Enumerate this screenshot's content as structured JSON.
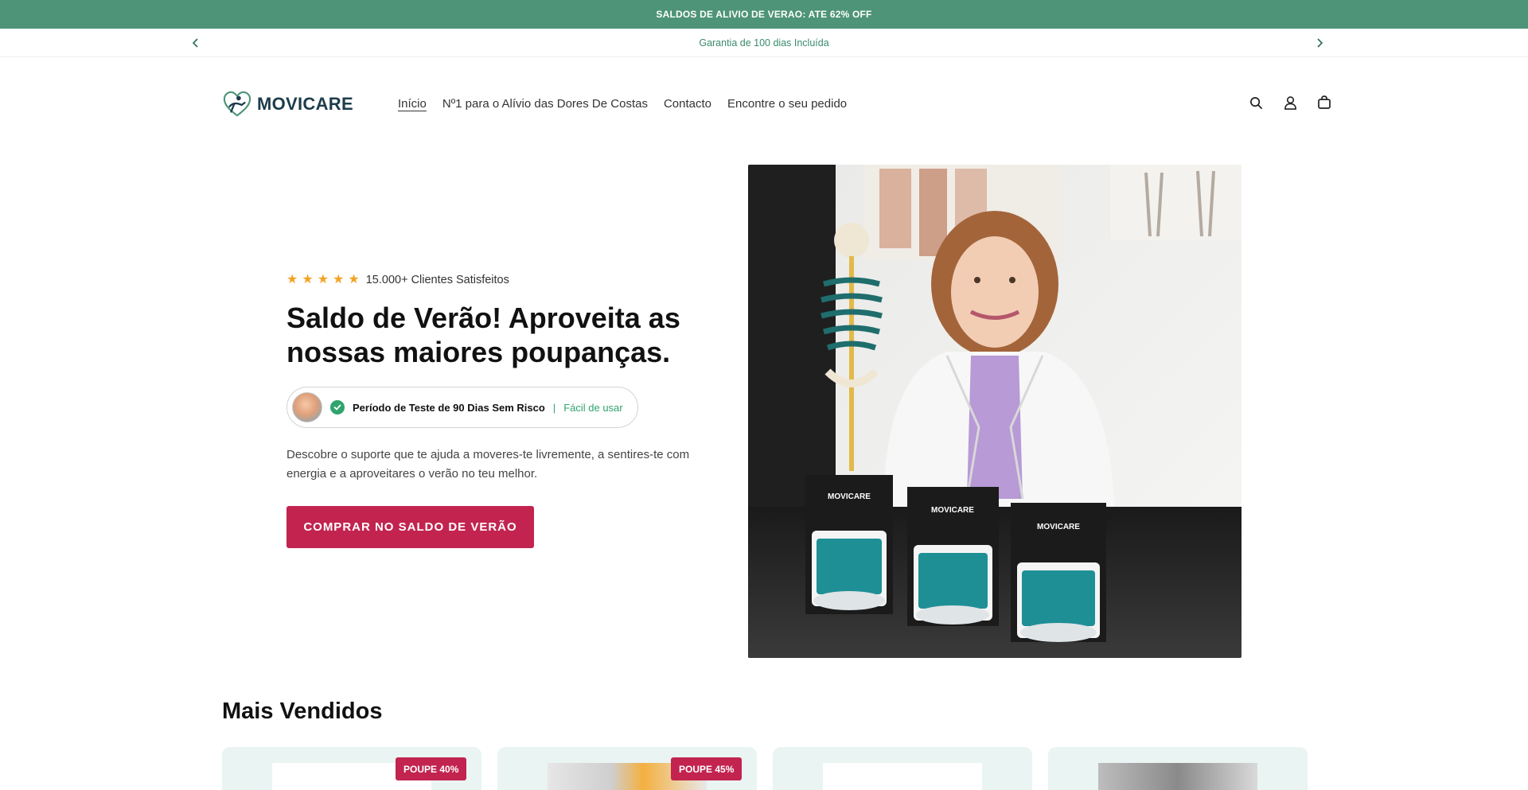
{
  "promo": {
    "text": "SALDOS DE ALIVIO DE VERAO: ATE 62% OFF"
  },
  "announcement": {
    "text": "Garantia de 100 dias Incluída"
  },
  "brand": {
    "name": "MOVICARE",
    "color": "#1d3c4b",
    "accent": "#4e9478"
  },
  "nav": {
    "items": [
      {
        "label": "Início"
      },
      {
        "label": "Nº1 para o Alívio das Dores De Costas"
      },
      {
        "label": "Contacto"
      },
      {
        "label": "Encontre o seu pedido"
      }
    ]
  },
  "header_icons": [
    "search-icon",
    "account-icon",
    "cart-icon"
  ],
  "hero": {
    "rating_text": "15.000+ Clientes Satisfeitos",
    "stars": 5,
    "title": "Saldo de Verão! Aproveita as nossas maiores poupanças.",
    "trust_strong": "Período de Teste de 90 Dias Sem Risco",
    "trust_sep": "|",
    "trust_easy": "Fácil de usar",
    "description": "Descobre o suporte que te ajuda a moveres-te livremente, a sentires-te com energia e a aproveitares o verão no teu melhor.",
    "cta": "COMPRAR NO SALDO DE VERÃO",
    "cta_color": "#c2244f",
    "image_box_brand": "MOVICARE"
  },
  "best_sellers": {
    "title": "Mais Vendidos",
    "cards": [
      {
        "badge": "POUPE 40%"
      },
      {
        "badge": "POUPE 45%"
      },
      {
        "badge": ""
      },
      {
        "badge": ""
      }
    ]
  }
}
